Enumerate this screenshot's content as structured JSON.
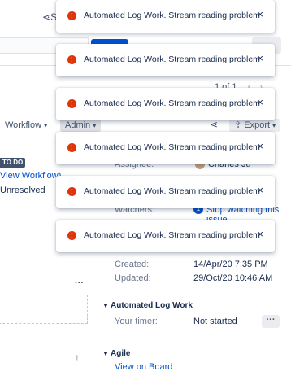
{
  "top": {
    "share_partial": "S"
  },
  "pager": {
    "label": "1 of 1"
  },
  "toolbar": {
    "workflow_label": "Workflow",
    "admin_label": "Admin",
    "export_label": "Export"
  },
  "issue": {
    "status": "TO DO",
    "view_workflow": "View Workflow)",
    "resolution": "Unresolved"
  },
  "people": {
    "assignee_partial": "Assignee:",
    "assignee_name_partial": "Charles Ju",
    "watchers_label": "Watchers:",
    "watch_count": "1",
    "stop_watching": "Stop watching this issue"
  },
  "dates": {
    "created_label": "Created:",
    "created_value": "14/Apr/20 7:35 PM",
    "updated_label": "Updated:",
    "updated_value": "29/Oct/20 10:46 AM"
  },
  "log_work": {
    "title": "Automated Log Work",
    "timer_label": "Your timer:",
    "timer_value": "Not started"
  },
  "agile": {
    "title": "Agile",
    "link": "View on Board"
  },
  "notifications": [
    {
      "message": "Automated Log Work. Stream reading problem"
    },
    {
      "message": "Automated Log Work. Stream reading problem"
    },
    {
      "message": "Automated Log Work. Stream reading problem"
    },
    {
      "message": "Automated Log Work. Stream reading problem"
    },
    {
      "message": "Automated Log Work. Stream reading problem"
    },
    {
      "message": "Automated Log Work. Stream reading problem"
    }
  ],
  "icons": {
    "close": "×",
    "error": "!",
    "more": "···",
    "up_arrow": "↑"
  }
}
